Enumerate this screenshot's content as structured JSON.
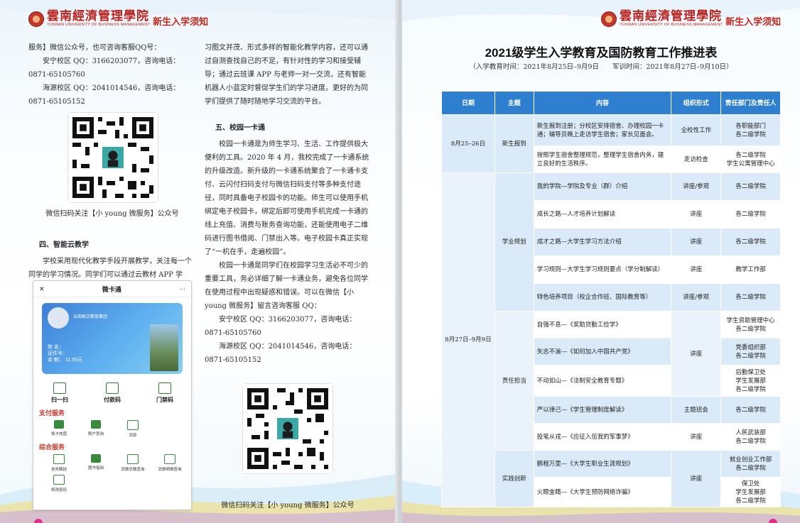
{
  "header": {
    "university_cn": "雲南經濟管理學院",
    "university_en": "YUNNAN UNIVERSITY OF BUSINESS MANAGEMENT",
    "tag": "新生入学须知"
  },
  "left": {
    "col1": {
      "p1": "服务】微信公众号，也可咨询客服QQ号：",
      "p2": "安宁校区 QQ：3166203077，咨询电话：0871-65105760",
      "p3": "海源校区 QQ：2041014546，咨询电话：0871-65105152",
      "qr_caption": "微信扫码关注【小 young 微服务】公众号",
      "h4": "四、智能云教学",
      "p4": "学校采用现代化教学手段开展教学，关注每一个同学的学习情况。同学们可以通过云教材 APP 学"
    },
    "col2": {
      "p1": "习图文并茂、形式多样的智能化教学内容，还可以通过自测查找自己的不足，有针对性的学习和接受辅导；通过云班课 APP 与老师一对一交流，还有智能机器人小蓝定时督促学生们的学习进度。更好的为同学们提供了随时随地学习交流的平台。",
      "h4": "五、校园一卡通",
      "p2": "校园一卡通是为师生学习、生活、工作提供极大便利的工具。2020 年 4 月，我校完成了一卡通系统的升级改造。新升级的一卡通系统聚合了一卡通卡支付、云闪付扫码支付与微信扫码支付等多种支付途径，同时具备电子校园卡的功能。师生可以使用手机绑定电子校园卡，绑定后即可使用手机完成一卡通的线上充值、消费与账务查询功能，还能使用电子二维码进行图书借阅、门禁出入等。电子校园卡真正实现了“一机在手，走遍校园”。",
      "p3": "校园一卡通是同学们在校园学习生活必不可少的重要工具，务必详细了解一卡通业务，避免各位同学在使用过程中出现疑惑和错误。可以在微信【小 young 微服务】留言咨询客服 QQ：",
      "p4": "安宁校区 QQ：3166203077，咨询电话：0871-65105760",
      "p5": "海源校区 QQ：2041014546，咨询电话：0871-65105152",
      "qr_caption": "微信扫码关注【小 young 微服务】公众号"
    },
    "phone": {
      "close": "✕",
      "title": "微卡通",
      "more": "···",
      "card_org": "云南融文教育集团",
      "card_name": "姓 名：",
      "card_id": "证件号：",
      "card_balance": "余 额： 11.55元",
      "quick": [
        "扫一扫",
        "付款码",
        "门禁码"
      ],
      "sec_pay": "支付服务",
      "pay_items": [
        "饭卡充值",
        "账户查询",
        "消息"
      ],
      "sec_all": "综合服务",
      "all_items": [
        "挂失解挂",
        "图书借阅",
        "消费总额查询",
        "消费明细查询"
      ],
      "pwd_item": "修改密码"
    }
  },
  "right": {
    "title": "2021级学生入学教育及国防教育工作推进表",
    "subtitle": "（入学教育时间：2021年8月25日–9月9日　　军训时间：2021年8月27日–9月10日）",
    "columns": [
      "日期",
      "主题",
      "内容",
      "组织形式",
      "责任部门及责任人"
    ],
    "dates": [
      "8月25–26日",
      "8月27日–9月9日"
    ],
    "themes": [
      "新生报到",
      "学业规划",
      "责任担当",
      "实践创新"
    ],
    "rows": [
      {
        "content": "新生报到注册；分校区安排宿舍、办理校园一卡通；辅导员晚上走访学生宿舍；家长见面会。",
        "form": "全校性工作",
        "dept": "各职能部门\n各二级学院"
      },
      {
        "content": "按照学生宿舍整理规范，整理学生宿舍内务，建立良好的生活秩序。",
        "form": "走访检查",
        "dept": "各二级学院\n学生公寓管理中心"
      },
      {
        "content": "我的学院—学院及专业（群）介绍",
        "form": "讲座/参观",
        "dept": "各二级学院"
      },
      {
        "content": "成长之路—人才培养计划解读",
        "form": "讲座",
        "dept": "各二级学院"
      },
      {
        "content": "成才之路—大学生学习方法介绍",
        "form": "讲座",
        "dept": "各二级学院"
      },
      {
        "content": "学习规则—大学生学习规则要点（学分制解读）",
        "form": "讲座",
        "dept": "教学工作部"
      },
      {
        "content": "特色培养项目（校企合作班、国际教育等）",
        "form": "讲座/参观",
        "dept": "各二级学院"
      },
      {
        "content": "自强不息—《奖助贷勤工俭学》",
        "form": "讲座",
        "dept": "学生资助管理中心\n各二级学院"
      },
      {
        "content": "矢志不渝—《如何加入中国共产党》",
        "form": "",
        "dept": "党委组织部\n各二级学院"
      },
      {
        "content": "不动如山—《法制安全教育专题》",
        "form": "",
        "dept": "后勤保卫处\n学生发展部\n各二级学院"
      },
      {
        "content": "严以律己—《学生管理制度解读》",
        "form": "主题班会",
        "dept": "各二级学院"
      },
      {
        "content": "投笔从戎—《应征入伍我的军事梦》",
        "form": "讲座",
        "dept": "人民武装部\n各二级学院"
      },
      {
        "content": "鹏程万里—《大学生职业生涯规划》",
        "form": "讲座",
        "dept": "就业创业工作部\n各二级学院"
      },
      {
        "content": "火眼金睛—《大学生预防网络诈骗》",
        "form": "",
        "dept": "保卫处\n学生发展部\n各二级学院"
      }
    ]
  }
}
